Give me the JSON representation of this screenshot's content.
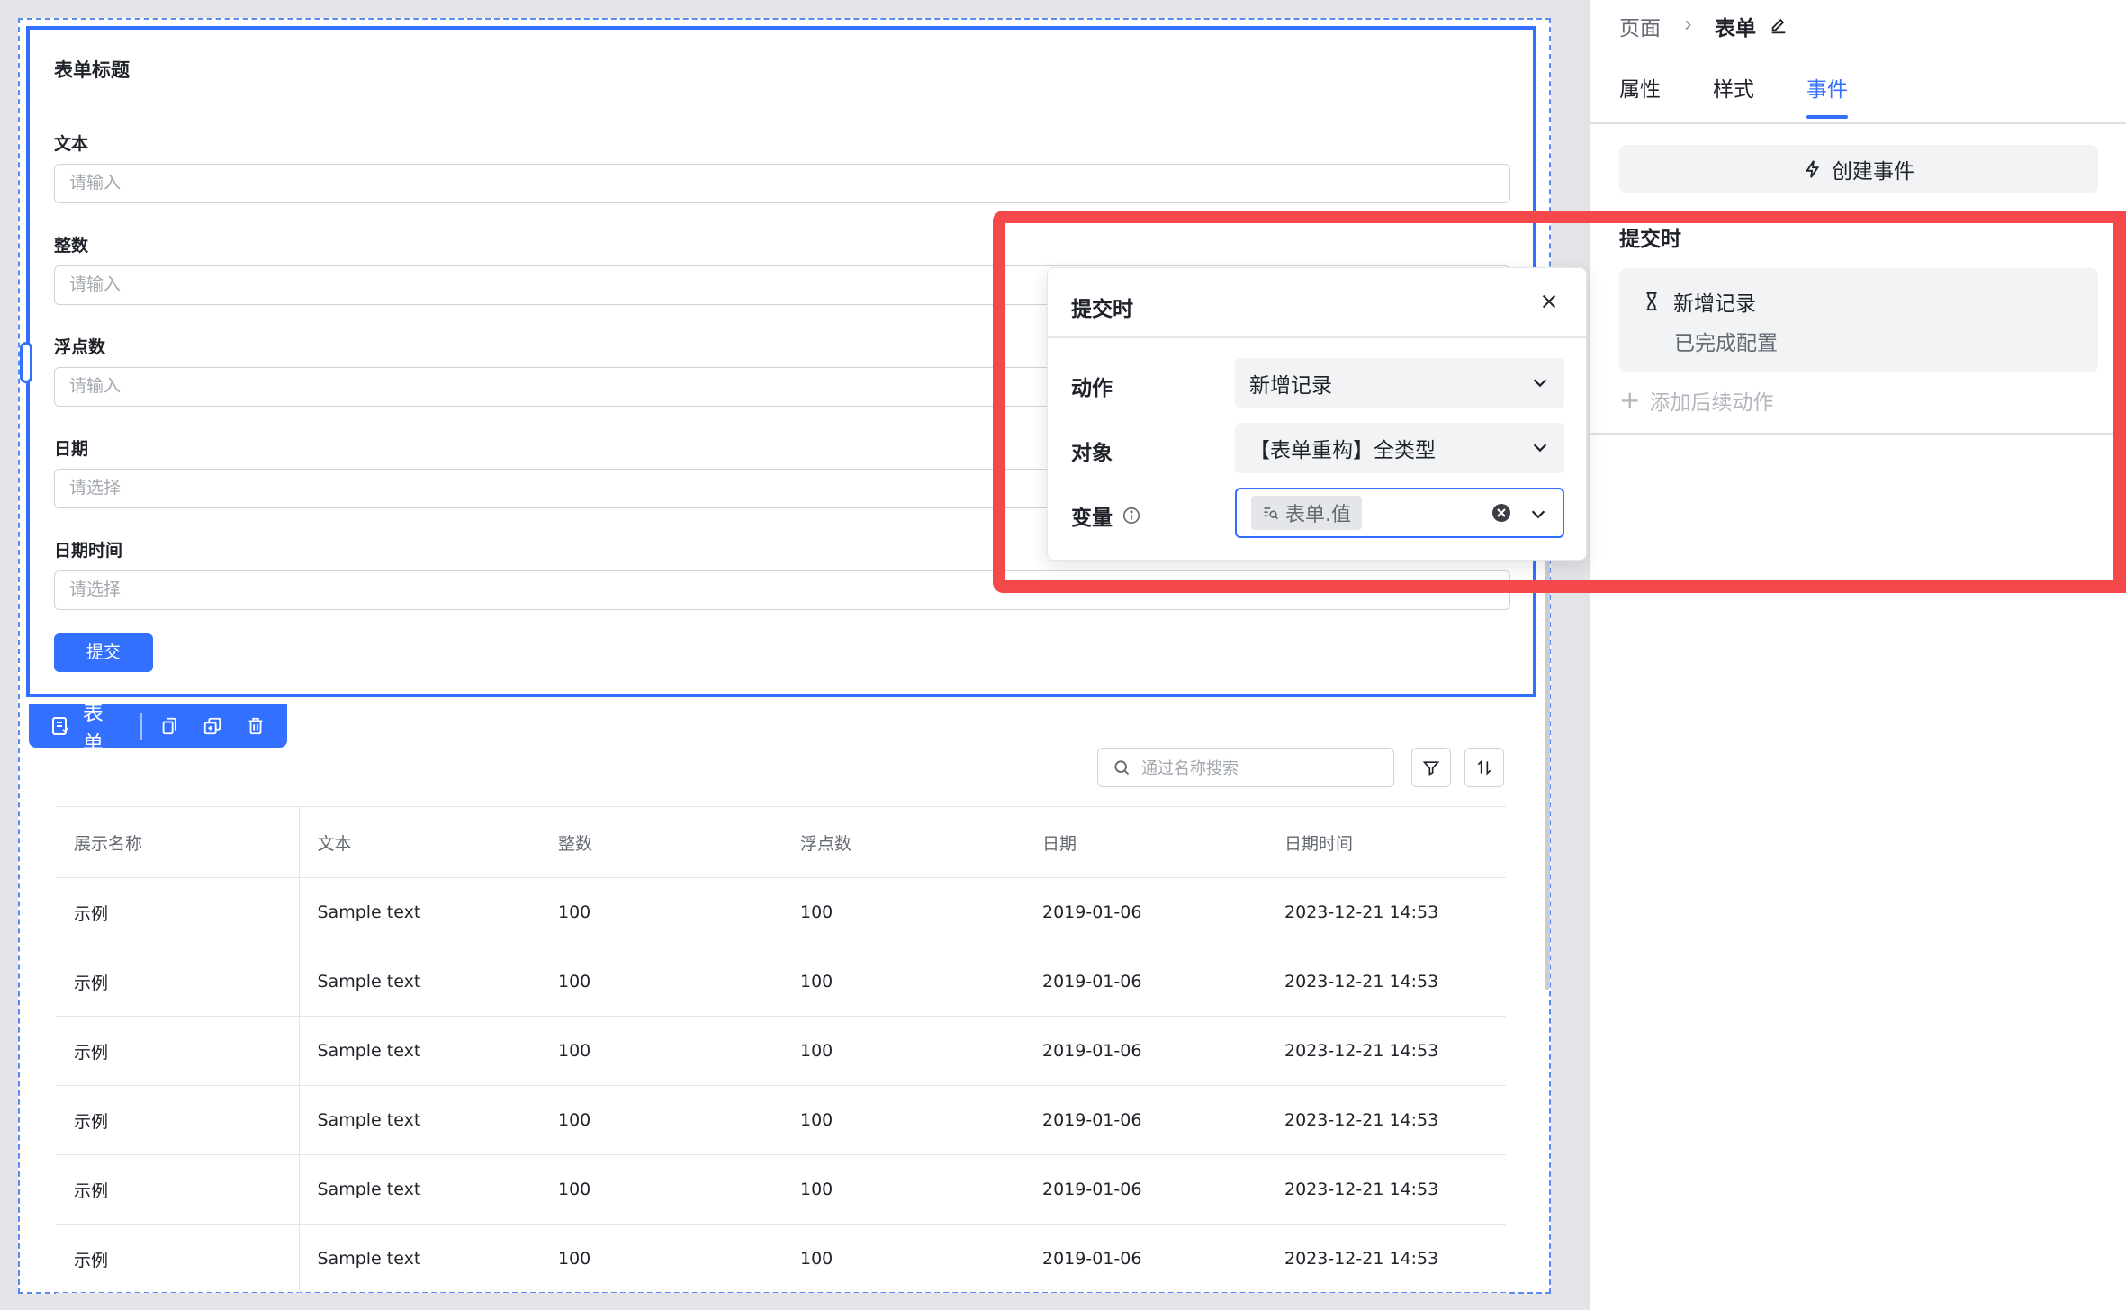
{
  "form": {
    "title": "表单标题",
    "fields": [
      {
        "label": "文本",
        "placeholder": "请输入"
      },
      {
        "label": "整数",
        "placeholder": "请输入"
      },
      {
        "label": "浮点数",
        "placeholder": "请输入"
      },
      {
        "label": "日期",
        "placeholder": "请选择"
      },
      {
        "label": "日期时间",
        "placeholder": "请选择"
      }
    ],
    "submit_label": "提交"
  },
  "toolbar": {
    "component_label": "表单",
    "icons": [
      "form-icon",
      "copy-icon",
      "duplicate-icon",
      "delete-icon"
    ]
  },
  "table": {
    "search_placeholder": "通过名称搜索",
    "columns": [
      "展示名称",
      "文本",
      "整数",
      "浮点数",
      "日期",
      "日期时间"
    ],
    "rows": [
      [
        "示例",
        "Sample text",
        "100",
        "100",
        "2019-01-06",
        "2023-12-21 14:53"
      ],
      [
        "示例",
        "Sample text",
        "100",
        "100",
        "2019-01-06",
        "2023-12-21 14:53"
      ],
      [
        "示例",
        "Sample text",
        "100",
        "100",
        "2019-01-06",
        "2023-12-21 14:53"
      ],
      [
        "示例",
        "Sample text",
        "100",
        "100",
        "2019-01-06",
        "2023-12-21 14:53"
      ],
      [
        "示例",
        "Sample text",
        "100",
        "100",
        "2019-01-06",
        "2023-12-21 14:53"
      ],
      [
        "示例",
        "Sample text",
        "100",
        "100",
        "2019-01-06",
        "2023-12-21 14:53"
      ]
    ]
  },
  "panel": {
    "breadcrumb": {
      "parent": "页面",
      "current": "表单"
    },
    "tabs": [
      {
        "label": "属性",
        "active": false
      },
      {
        "label": "样式",
        "active": false
      },
      {
        "label": "事件",
        "active": true
      }
    ],
    "create_event_label": "创建事件",
    "event_heading": "提交时",
    "event_action": "新增记录",
    "event_status": "已完成配置",
    "add_action_label": "添加后续动作"
  },
  "popover": {
    "title": "提交时",
    "action_label": "动作",
    "action_value": "新增记录",
    "object_label": "对象",
    "object_value": "【表单重构】全类型",
    "variable_label": "变量",
    "variable_tag": "表单.值"
  },
  "colors": {
    "accent": "#3370ff",
    "highlight": "#f5484a"
  }
}
